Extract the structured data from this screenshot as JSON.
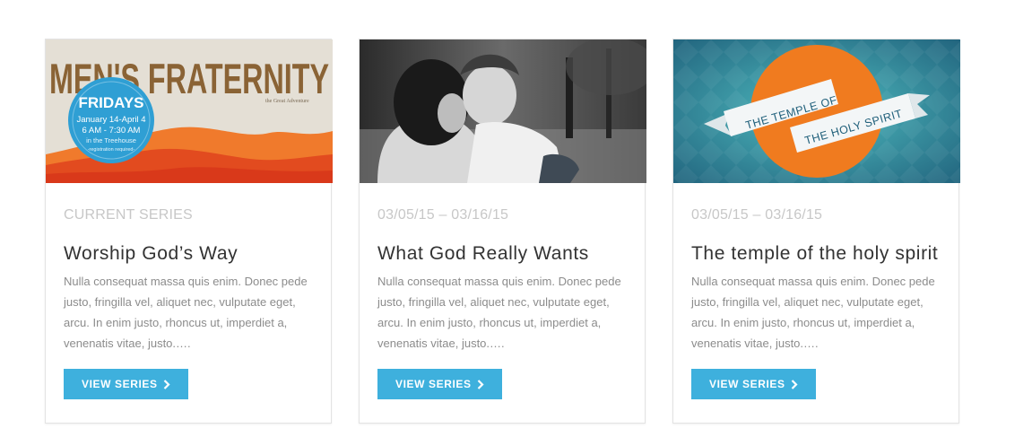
{
  "cards": [
    {
      "image": {
        "headline": "MEN'S FRATERNITY",
        "tagline": "the Great Adventure",
        "badge_title": "FRIDAYS",
        "badge_dates": "January 14-April 4",
        "badge_time": "6 AM - 7:30 AM",
        "badge_place": "in the Treehouse",
        "badge_note": "-registration required-"
      },
      "meta": "CURRENT SERIES",
      "title": "Worship God’s Way",
      "description": "Nulla consequat massa quis enim. Donec pede justo, fringilla vel, aliquet nec, vulputate eget, arcu. In enim justo, rhoncus ut, imperdiet a, venenatis vitae, justo.….",
      "button_label": "VIEW SERIES"
    },
    {
      "image": {},
      "meta": "03/05/15 – 03/16/15",
      "title": "What God Really Wants",
      "description": "Nulla consequat massa quis enim. Donec pede justo, fringilla vel, aliquet nec, vulputate eget, arcu. In enim justo, rhoncus ut, imperdiet a, venenatis vitae, justo.….",
      "button_label": "VIEW SERIES"
    },
    {
      "image": {
        "ribbon_line1": "THE TEMPLE OF",
        "ribbon_line2": "THE HOLY SPIRIT"
      },
      "meta": "03/05/15 – 03/16/15",
      "title": "The temple of the holy spirit",
      "description": "Nulla consequat massa quis enim. Donec pede justo, fringilla vel, aliquet nec, vulputate eget, arcu. In enim justo, rhoncus ut, imperdiet a, venenatis vitae, justo.….",
      "button_label": "VIEW SERIES"
    }
  ],
  "colors": {
    "button": "#3eb0dd",
    "meta": "#c7c7c7",
    "title": "#333333",
    "description": "#8c8c8c"
  },
  "icons": {
    "button_chevron": "chevron-right-icon"
  }
}
